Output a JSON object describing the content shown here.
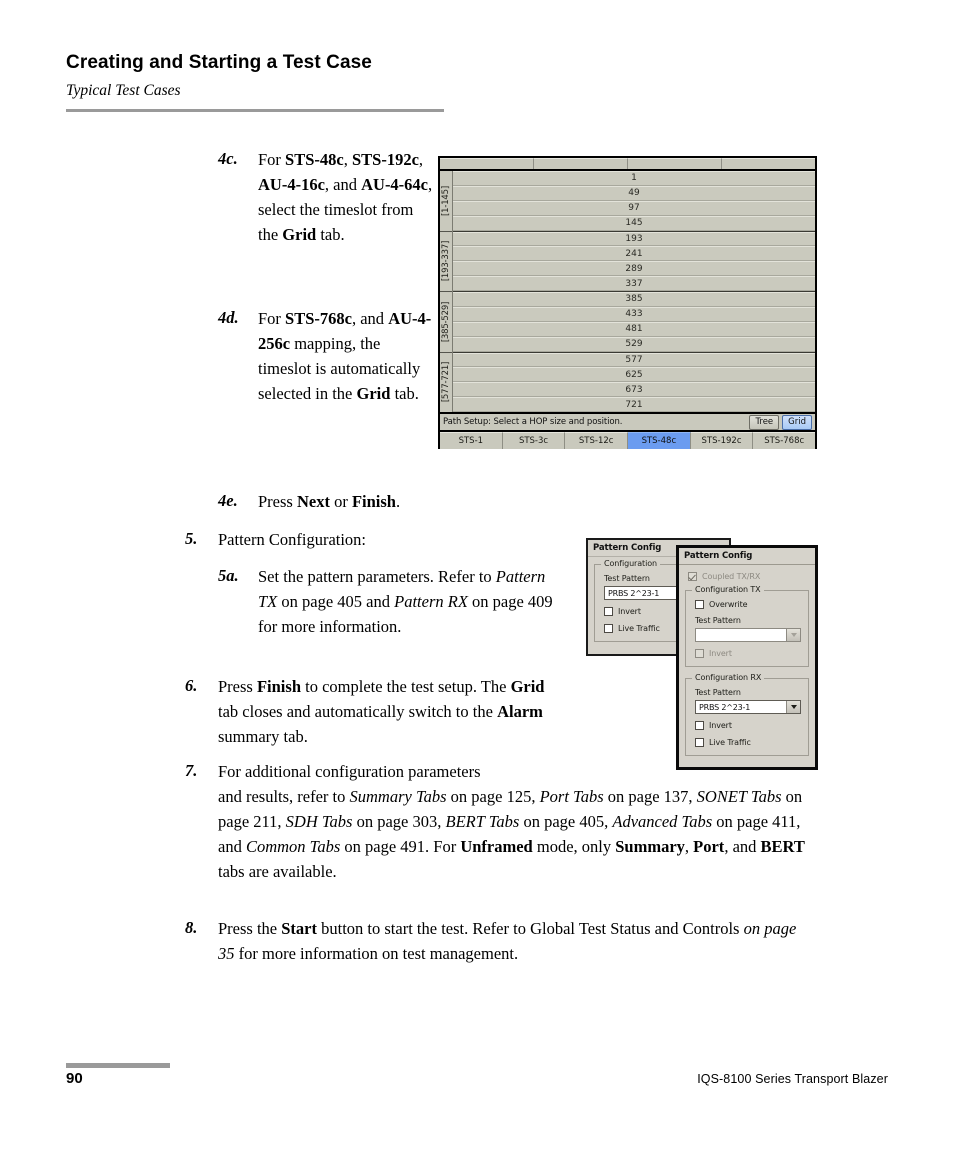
{
  "header": {
    "chapter_title": "Creating and Starting a Test Case",
    "section_title": "Typical Test Cases"
  },
  "footer": {
    "page_number": "90",
    "product": "IQS-8100 Series Transport Blazer"
  },
  "steps": {
    "s4c_marker": "4c.",
    "s4d_marker": "4d.",
    "s4e_marker": "4e.",
    "s5_marker": "5.",
    "s5a_marker": "5a.",
    "s6_marker": "6.",
    "s7_marker": "7.",
    "s8_marker": "8.",
    "s5_text": "Pattern Configuration:"
  },
  "grid_figure": {
    "column_headers": [
      "",
      "",
      "",
      ""
    ],
    "row_labels": [
      "[1-145]",
      "[193-337]",
      "[385-529]",
      "[577-721]"
    ],
    "groups": [
      [
        "1",
        "49",
        "97",
        "145"
      ],
      [
        "193",
        "241",
        "289",
        "337"
      ],
      [
        "385",
        "433",
        "481",
        "529"
      ],
      [
        "577",
        "625",
        "673",
        "721"
      ]
    ],
    "status_text": "Path Setup: Select a HOP size and position.",
    "view_buttons": [
      {
        "label": "Tree",
        "selected": false
      },
      {
        "label": "Grid",
        "selected": true
      }
    ],
    "tabs": [
      {
        "label": "STS-1",
        "selected": false
      },
      {
        "label": "STS-3c",
        "selected": false
      },
      {
        "label": "STS-12c",
        "selected": false
      },
      {
        "label": "STS-48c",
        "selected": true
      },
      {
        "label": "STS-192c",
        "selected": false
      },
      {
        "label": "STS-768c",
        "selected": false
      }
    ],
    "selected_tab_color": "#6b9cf0",
    "window_background": "#c9c9bd"
  },
  "pattern_figure": {
    "back_dialog": {
      "title": "Pattern Config",
      "group_label": "Configuration",
      "test_pattern_label": "Test Pattern",
      "test_pattern_value": "PRBS 2^23-1",
      "invert_label": "Invert",
      "live_traffic_label": "Live Traffic"
    },
    "front_dialog": {
      "title": "Pattern Config",
      "coupled_label": "Coupled TX/RX",
      "tx_group_label": "Configuration TX",
      "tx_overwrite_label": "Overwrite",
      "tx_test_pattern_label": "Test Pattern",
      "tx_test_pattern_value": "",
      "tx_invert_label": "Invert",
      "rx_group_label": "Configuration RX",
      "rx_test_pattern_label": "Test Pattern",
      "rx_test_pattern_value": "PRBS 2^23-1",
      "rx_invert_label": "Invert",
      "rx_live_traffic_label": "Live Traffic"
    }
  }
}
